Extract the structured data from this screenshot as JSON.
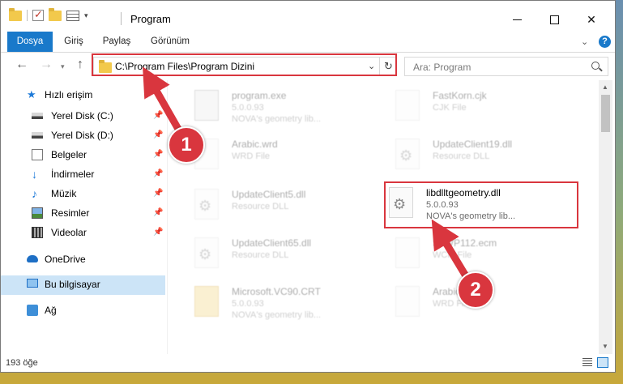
{
  "window": {
    "title": "Program"
  },
  "ribbon": {
    "tabs": [
      "Dosya",
      "Giriş",
      "Paylaş",
      "Görünüm"
    ]
  },
  "nav": {
    "address": "C:\\Program Files\\Program Dizini",
    "search_placeholder": "Ara: Program"
  },
  "sidebar": {
    "items": [
      {
        "label": "Hızlı erişim",
        "icon": "star-icon"
      },
      {
        "label": "Yerel Disk (C:)",
        "icon": "disk-icon",
        "pinned": true
      },
      {
        "label": "Yerel Disk (D:)",
        "icon": "disk-icon",
        "pinned": true
      },
      {
        "label": "Belgeler",
        "icon": "documents-icon",
        "pinned": true
      },
      {
        "label": "İndirmeler",
        "icon": "download-icon",
        "pinned": true
      },
      {
        "label": "Müzik",
        "icon": "music-icon",
        "pinned": true
      },
      {
        "label": "Resimler",
        "icon": "pictures-icon",
        "pinned": true
      },
      {
        "label": "Videolar",
        "icon": "videos-icon",
        "pinned": true
      },
      {
        "label": "OneDrive",
        "icon": "cloud-icon"
      },
      {
        "label": "Bu bilgisayar",
        "icon": "computer-icon",
        "selected": true
      },
      {
        "label": "Ağ",
        "icon": "network-icon"
      }
    ]
  },
  "files": [
    {
      "name": "program.exe",
      "sub1": "5.0.0.93",
      "sub2": "NOVA's geometry lib...",
      "icon": "exe-icon"
    },
    {
      "name": "FastKorn.cjk",
      "sub1": "CJK File",
      "sub2": "",
      "icon": "file-icon"
    },
    {
      "name": "Arabic.wrd",
      "sub1": "WRD File",
      "sub2": "",
      "icon": "file-icon"
    },
    {
      "name": "UpdateClient19.dll",
      "sub1": "Resource DLL",
      "sub2": "",
      "icon": "dll-icon"
    },
    {
      "name": "UpdateClient5.dll",
      "sub1": "Resource DLL",
      "sub2": "",
      "icon": "dll-icon"
    },
    {
      "name": "libdlltgeometry.dll",
      "sub1": "5.0.0.93",
      "sub2": "NOVA's geometry lib...",
      "icon": "dll-icon"
    },
    {
      "name": "UpdateClient65.dll",
      "sub1": "Resource DLL",
      "sub2": "",
      "icon": "dll-icon"
    },
    {
      "name": "ShWP112.ecm",
      "sub1": "WCM File",
      "sub2": "",
      "icon": "file-icon"
    },
    {
      "name": "Microsoft.VC90.CRT",
      "sub1": "5.0.0.93",
      "sub2": "NOVA's geometry lib...",
      "icon": "folder-icon"
    },
    {
      "name": "Arabic...",
      "sub1": "WRD File",
      "sub2": "",
      "icon": "file-icon"
    }
  ],
  "status": {
    "count": "193 öğe"
  },
  "annotations": {
    "badge1": "1",
    "badge2": "2",
    "color": "#d9363e"
  }
}
